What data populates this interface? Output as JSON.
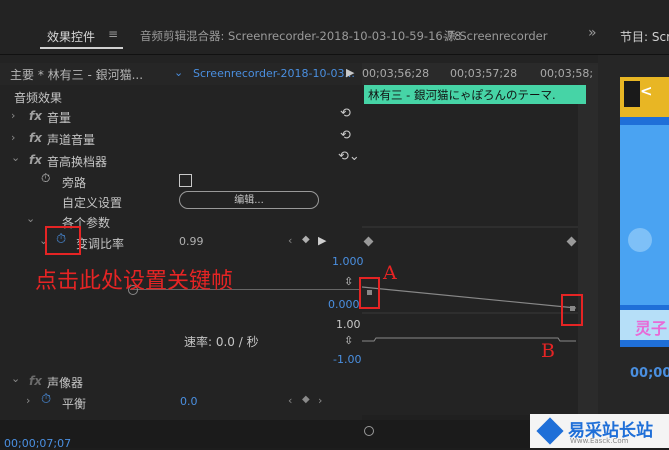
{
  "tabs": {
    "effect_controls": "效果控件",
    "effect_controls_menu": "≡",
    "audio_mixer": "音频剪辑混合器: Screenrecorder-2018-10-03-10-59-16-78",
    "source": "源:Screenrecorder",
    "overflow": "»",
    "program": "节目: Scr"
  },
  "clip_header": {
    "master": "主要 * 林有三 - 銀河猫...",
    "clip": "Screenrecorder-2018-10-03...",
    "play": "▶"
  },
  "timecodes": [
    "00;03;56;28",
    "00;03;57;28",
    "00;03;58;"
  ],
  "timeline_clip_label": "林有三 - 銀河猫にゃぽろんのテーマ.",
  "sections": {
    "audio_effects": "音频效果",
    "volume": "音量",
    "channel_volume": "声道音量",
    "pitch_shifter": "音高换档器",
    "bypass": "旁路",
    "custom_setup": "自定义设置",
    "edit_button": "编辑...",
    "params": "各个参数",
    "pitch_ratio": "变调比率",
    "pitch_ratio_value": "0.99",
    "panner": "声像器",
    "balance": "平衡",
    "balance_value": "0.0"
  },
  "graph": {
    "value_max": "1.000",
    "value_min": "0.000",
    "velocity_max": "1.00",
    "velocity_min": "-1.00",
    "velocity_label": "速率: 0.0 / 秒"
  },
  "fx_badge": "fx",
  "annotations": {
    "instruction": "点击此处设置关键帧",
    "point_a": "A",
    "point_b": "B"
  },
  "program_monitor": {
    "timecode": "00;00;",
    "overlay_text": "灵子"
  },
  "bottom_timecode": "00;00;07;07",
  "watermark": {
    "brand": "易采站长站",
    "url": "Www.Easck.Com"
  },
  "colors": {
    "accent_blue": "#4a8fe0",
    "clip_green": "#46d4a6",
    "annotation_red": "#e52424"
  }
}
